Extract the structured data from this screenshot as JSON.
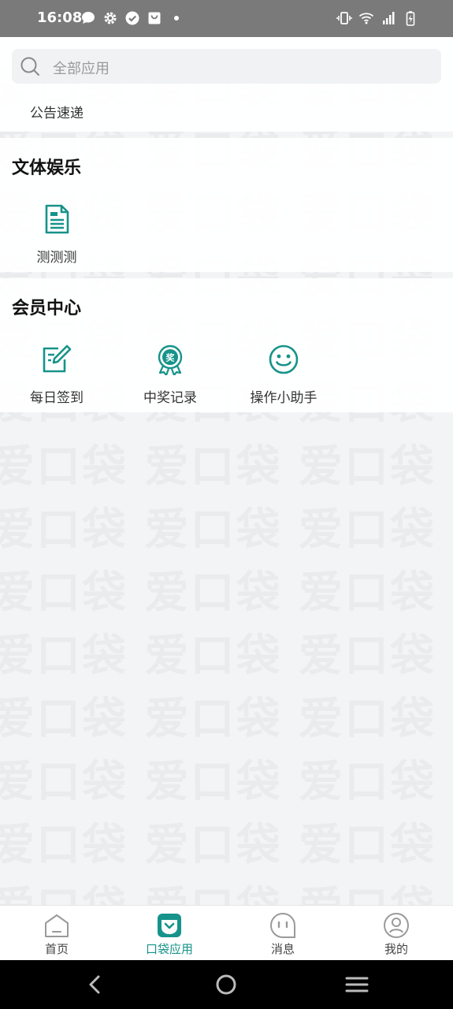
{
  "status_bar": {
    "time": "16:08",
    "left_icons": [
      "chat-bubble-icon",
      "gear-icon",
      "check-circle-icon",
      "shopping-bag-icon",
      "dot-icon"
    ],
    "right_icons": [
      "vibrate-icon",
      "wifi-icon",
      "signal-icon",
      "battery-charging-icon"
    ]
  },
  "search": {
    "placeholder": "全部应用"
  },
  "notice": {
    "label": "公告速递"
  },
  "sections": [
    {
      "title": "文体娱乐",
      "apps": [
        {
          "label": "测测测",
          "icon": "document-icon"
        }
      ]
    },
    {
      "title": "会员中心",
      "apps": [
        {
          "label": "每日签到",
          "icon": "edit-checkin-icon"
        },
        {
          "label": "中奖记录",
          "icon": "award-badge-icon"
        },
        {
          "label": "操作小助手",
          "icon": "smiley-icon"
        }
      ]
    }
  ],
  "watermark": {
    "text": "爱口袋"
  },
  "tabbar": {
    "tabs": [
      {
        "label": "首页",
        "icon": "home-icon",
        "active": false
      },
      {
        "label": "口袋应用",
        "icon": "pocket-icon",
        "active": true
      },
      {
        "label": "消息",
        "icon": "message-icon",
        "active": false
      },
      {
        "label": "我的",
        "icon": "profile-icon",
        "active": false
      }
    ]
  },
  "colors": {
    "accent": "#16938a",
    "background": "#f3f4f6",
    "status_bar": "#7a7a7a"
  },
  "navbar": {
    "buttons": [
      "back-icon",
      "home-circle-icon",
      "menu-icon"
    ]
  }
}
